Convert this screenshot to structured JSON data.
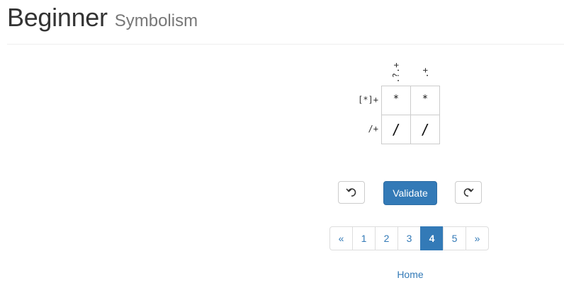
{
  "header": {
    "title": "Beginner",
    "subtitle": "Symbolism"
  },
  "puzzle": {
    "column_clues": [
      ".?.+",
      ".+"
    ],
    "row_clues": [
      "[*]+",
      "/+"
    ],
    "cells": [
      [
        "*",
        "*"
      ],
      [
        "/",
        "/"
      ]
    ]
  },
  "controls": {
    "undo_icon": "undo-icon",
    "validate_label": "Validate",
    "redo_icon": "redo-icon"
  },
  "pagination": {
    "prev_label": "«",
    "pages": [
      "1",
      "2",
      "3",
      "4",
      "5"
    ],
    "active_page": "4",
    "next_label": "»"
  },
  "footer": {
    "home_label": "Home"
  },
  "colors": {
    "primary": "#337ab7",
    "text": "#333333",
    "subtitle": "#777777",
    "border": "#cccccc"
  }
}
